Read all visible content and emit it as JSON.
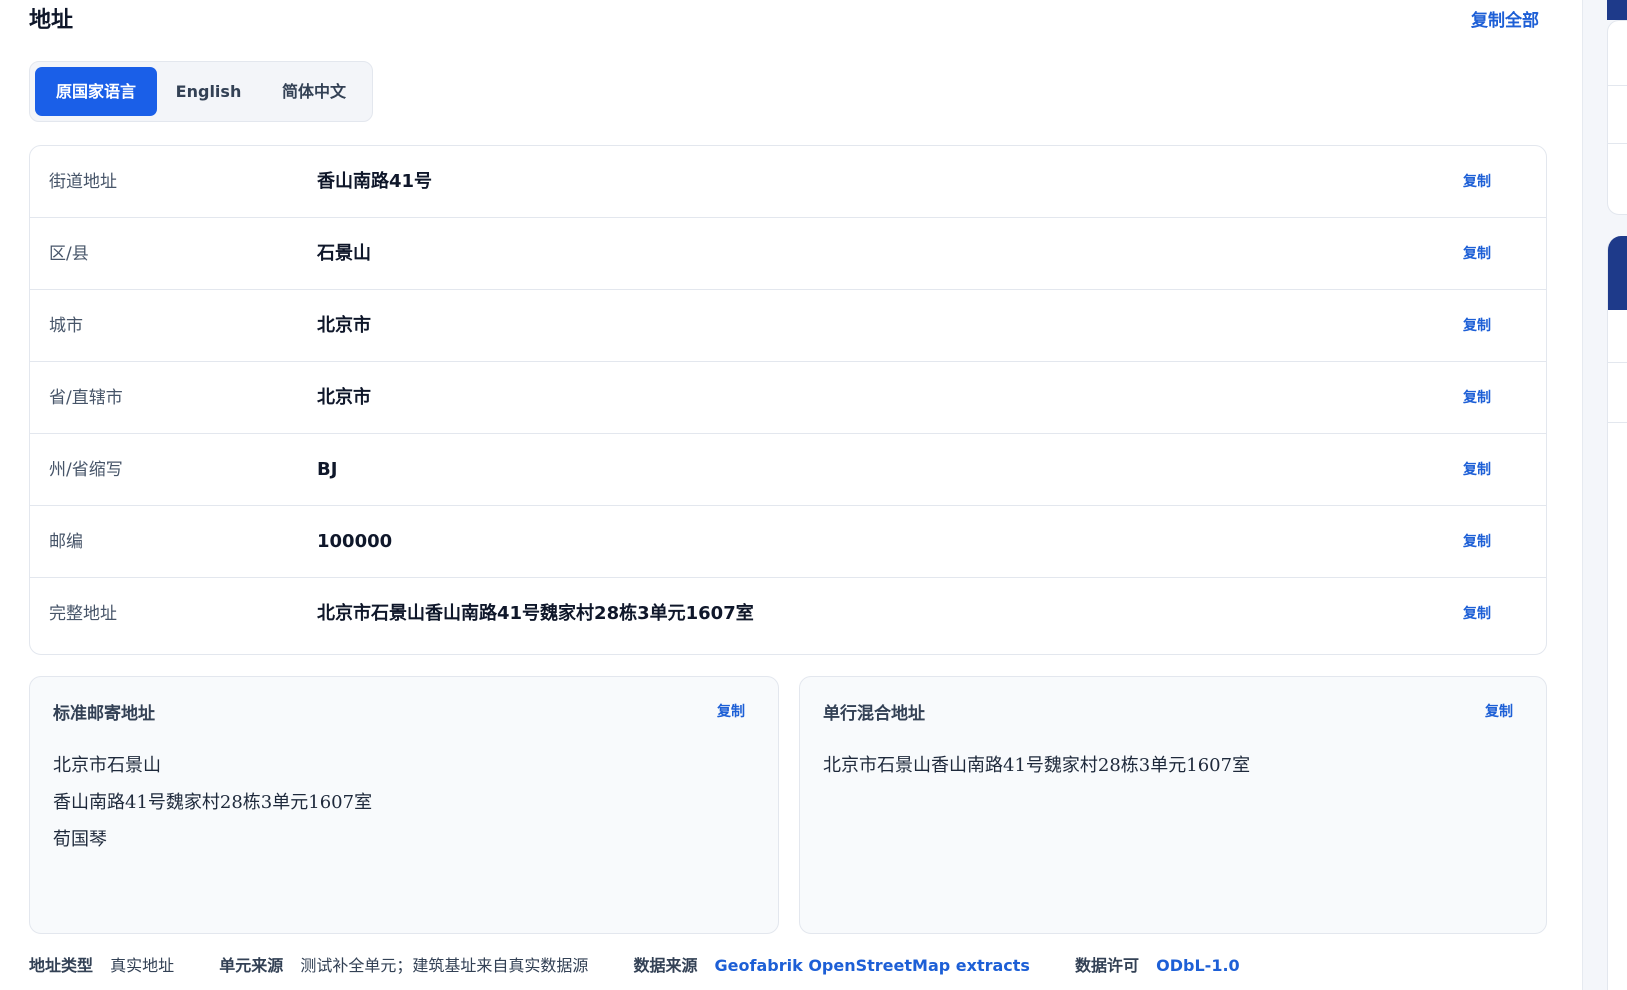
{
  "header": {
    "title": "地址",
    "copy_all": "复制全部"
  },
  "tabs": [
    {
      "label": "原国家语言",
      "active": true
    },
    {
      "label": "English",
      "active": false
    },
    {
      "label": "简体中文",
      "active": false
    }
  ],
  "fields": [
    {
      "label": "街道地址",
      "value": "香山南路41号",
      "copy": "复制"
    },
    {
      "label": "区/县",
      "value": "石景山",
      "copy": "复制"
    },
    {
      "label": "城市",
      "value": "北京市",
      "copy": "复制"
    },
    {
      "label": "省/直辖市",
      "value": "北京市",
      "copy": "复制"
    },
    {
      "label": "州/省缩写",
      "value": "BJ",
      "copy": "复制"
    },
    {
      "label": "邮编",
      "value": "100000",
      "copy": "复制"
    },
    {
      "label": "完整地址",
      "value": "北京市石景山香山南路41号魏家村28栋3单元1607室",
      "copy": "复制"
    }
  ],
  "postal_card": {
    "title": "标准邮寄地址",
    "copy": "复制",
    "lines": [
      "北京市石景山",
      "香山南路41号魏家村28栋3单元1607室",
      "荀国琴"
    ]
  },
  "single_line_card": {
    "title": "单行混合地址",
    "copy": "复制",
    "lines": [
      "北京市石景山香山南路41号魏家村28栋3单元1607室"
    ]
  },
  "meta": {
    "address_type_label": "地址类型",
    "address_type_value": "真实地址",
    "unit_source_label": "单元来源",
    "unit_source_value": "测试补全单元；建筑基址来自真实数据源",
    "data_source_label": "数据来源",
    "data_source_value": "Geofabrik OpenStreetMap extracts",
    "license_label": "数据许可",
    "license_value": "ODbL-1.0"
  },
  "colors": {
    "accent": "#1a5fe8",
    "link": "#1d5fd6",
    "rail_dark": "#1e3a8a"
  }
}
